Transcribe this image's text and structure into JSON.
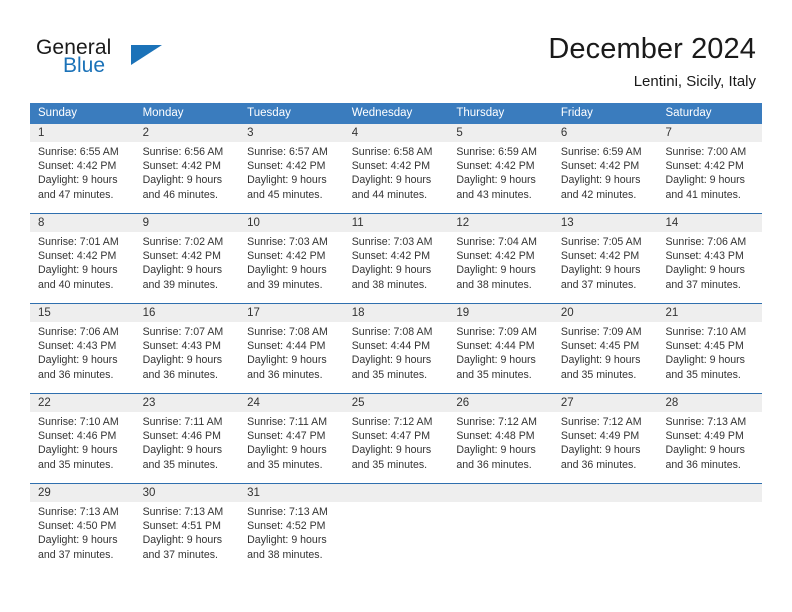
{
  "brand": {
    "name_part1": "General",
    "name_part2": "Blue",
    "accent_color": "#1b72b8",
    "flag_icon": "triangle-flag-icon"
  },
  "header": {
    "month_title": "December 2024",
    "location": "Lentini, Sicily, Italy"
  },
  "theme": {
    "header_bg": "#3a7cbe",
    "daynum_bg": "#eeeeee",
    "rule_color": "#2f6fae",
    "text_color": "#333333"
  },
  "calendar": {
    "weekday_headers": [
      "Sunday",
      "Monday",
      "Tuesday",
      "Wednesday",
      "Thursday",
      "Friday",
      "Saturday"
    ],
    "weeks": [
      [
        {
          "day": "1",
          "sunrise": "Sunrise: 6:55 AM",
          "sunset": "Sunset: 4:42 PM",
          "daylight1": "Daylight: 9 hours",
          "daylight2": "and 47 minutes."
        },
        {
          "day": "2",
          "sunrise": "Sunrise: 6:56 AM",
          "sunset": "Sunset: 4:42 PM",
          "daylight1": "Daylight: 9 hours",
          "daylight2": "and 46 minutes."
        },
        {
          "day": "3",
          "sunrise": "Sunrise: 6:57 AM",
          "sunset": "Sunset: 4:42 PM",
          "daylight1": "Daylight: 9 hours",
          "daylight2": "and 45 minutes."
        },
        {
          "day": "4",
          "sunrise": "Sunrise: 6:58 AM",
          "sunset": "Sunset: 4:42 PM",
          "daylight1": "Daylight: 9 hours",
          "daylight2": "and 44 minutes."
        },
        {
          "day": "5",
          "sunrise": "Sunrise: 6:59 AM",
          "sunset": "Sunset: 4:42 PM",
          "daylight1": "Daylight: 9 hours",
          "daylight2": "and 43 minutes."
        },
        {
          "day": "6",
          "sunrise": "Sunrise: 6:59 AM",
          "sunset": "Sunset: 4:42 PM",
          "daylight1": "Daylight: 9 hours",
          "daylight2": "and 42 minutes."
        },
        {
          "day": "7",
          "sunrise": "Sunrise: 7:00 AM",
          "sunset": "Sunset: 4:42 PM",
          "daylight1": "Daylight: 9 hours",
          "daylight2": "and 41 minutes."
        }
      ],
      [
        {
          "day": "8",
          "sunrise": "Sunrise: 7:01 AM",
          "sunset": "Sunset: 4:42 PM",
          "daylight1": "Daylight: 9 hours",
          "daylight2": "and 40 minutes."
        },
        {
          "day": "9",
          "sunrise": "Sunrise: 7:02 AM",
          "sunset": "Sunset: 4:42 PM",
          "daylight1": "Daylight: 9 hours",
          "daylight2": "and 39 minutes."
        },
        {
          "day": "10",
          "sunrise": "Sunrise: 7:03 AM",
          "sunset": "Sunset: 4:42 PM",
          "daylight1": "Daylight: 9 hours",
          "daylight2": "and 39 minutes."
        },
        {
          "day": "11",
          "sunrise": "Sunrise: 7:03 AM",
          "sunset": "Sunset: 4:42 PM",
          "daylight1": "Daylight: 9 hours",
          "daylight2": "and 38 minutes."
        },
        {
          "day": "12",
          "sunrise": "Sunrise: 7:04 AM",
          "sunset": "Sunset: 4:42 PM",
          "daylight1": "Daylight: 9 hours",
          "daylight2": "and 38 minutes."
        },
        {
          "day": "13",
          "sunrise": "Sunrise: 7:05 AM",
          "sunset": "Sunset: 4:42 PM",
          "daylight1": "Daylight: 9 hours",
          "daylight2": "and 37 minutes."
        },
        {
          "day": "14",
          "sunrise": "Sunrise: 7:06 AM",
          "sunset": "Sunset: 4:43 PM",
          "daylight1": "Daylight: 9 hours",
          "daylight2": "and 37 minutes."
        }
      ],
      [
        {
          "day": "15",
          "sunrise": "Sunrise: 7:06 AM",
          "sunset": "Sunset: 4:43 PM",
          "daylight1": "Daylight: 9 hours",
          "daylight2": "and 36 minutes."
        },
        {
          "day": "16",
          "sunrise": "Sunrise: 7:07 AM",
          "sunset": "Sunset: 4:43 PM",
          "daylight1": "Daylight: 9 hours",
          "daylight2": "and 36 minutes."
        },
        {
          "day": "17",
          "sunrise": "Sunrise: 7:08 AM",
          "sunset": "Sunset: 4:44 PM",
          "daylight1": "Daylight: 9 hours",
          "daylight2": "and 36 minutes."
        },
        {
          "day": "18",
          "sunrise": "Sunrise: 7:08 AM",
          "sunset": "Sunset: 4:44 PM",
          "daylight1": "Daylight: 9 hours",
          "daylight2": "and 35 minutes."
        },
        {
          "day": "19",
          "sunrise": "Sunrise: 7:09 AM",
          "sunset": "Sunset: 4:44 PM",
          "daylight1": "Daylight: 9 hours",
          "daylight2": "and 35 minutes."
        },
        {
          "day": "20",
          "sunrise": "Sunrise: 7:09 AM",
          "sunset": "Sunset: 4:45 PM",
          "daylight1": "Daylight: 9 hours",
          "daylight2": "and 35 minutes."
        },
        {
          "day": "21",
          "sunrise": "Sunrise: 7:10 AM",
          "sunset": "Sunset: 4:45 PM",
          "daylight1": "Daylight: 9 hours",
          "daylight2": "and 35 minutes."
        }
      ],
      [
        {
          "day": "22",
          "sunrise": "Sunrise: 7:10 AM",
          "sunset": "Sunset: 4:46 PM",
          "daylight1": "Daylight: 9 hours",
          "daylight2": "and 35 minutes."
        },
        {
          "day": "23",
          "sunrise": "Sunrise: 7:11 AM",
          "sunset": "Sunset: 4:46 PM",
          "daylight1": "Daylight: 9 hours",
          "daylight2": "and 35 minutes."
        },
        {
          "day": "24",
          "sunrise": "Sunrise: 7:11 AM",
          "sunset": "Sunset: 4:47 PM",
          "daylight1": "Daylight: 9 hours",
          "daylight2": "and 35 minutes."
        },
        {
          "day": "25",
          "sunrise": "Sunrise: 7:12 AM",
          "sunset": "Sunset: 4:47 PM",
          "daylight1": "Daylight: 9 hours",
          "daylight2": "and 35 minutes."
        },
        {
          "day": "26",
          "sunrise": "Sunrise: 7:12 AM",
          "sunset": "Sunset: 4:48 PM",
          "daylight1": "Daylight: 9 hours",
          "daylight2": "and 36 minutes."
        },
        {
          "day": "27",
          "sunrise": "Sunrise: 7:12 AM",
          "sunset": "Sunset: 4:49 PM",
          "daylight1": "Daylight: 9 hours",
          "daylight2": "and 36 minutes."
        },
        {
          "day": "28",
          "sunrise": "Sunrise: 7:13 AM",
          "sunset": "Sunset: 4:49 PM",
          "daylight1": "Daylight: 9 hours",
          "daylight2": "and 36 minutes."
        }
      ],
      [
        {
          "day": "29",
          "sunrise": "Sunrise: 7:13 AM",
          "sunset": "Sunset: 4:50 PM",
          "daylight1": "Daylight: 9 hours",
          "daylight2": "and 37 minutes."
        },
        {
          "day": "30",
          "sunrise": "Sunrise: 7:13 AM",
          "sunset": "Sunset: 4:51 PM",
          "daylight1": "Daylight: 9 hours",
          "daylight2": "and 37 minutes."
        },
        {
          "day": "31",
          "sunrise": "Sunrise: 7:13 AM",
          "sunset": "Sunset: 4:52 PM",
          "daylight1": "Daylight: 9 hours",
          "daylight2": "and 38 minutes."
        },
        {
          "day": "",
          "sunrise": "",
          "sunset": "",
          "daylight1": "",
          "daylight2": ""
        },
        {
          "day": "",
          "sunrise": "",
          "sunset": "",
          "daylight1": "",
          "daylight2": ""
        },
        {
          "day": "",
          "sunrise": "",
          "sunset": "",
          "daylight1": "",
          "daylight2": ""
        },
        {
          "day": "",
          "sunrise": "",
          "sunset": "",
          "daylight1": "",
          "daylight2": ""
        }
      ]
    ]
  }
}
